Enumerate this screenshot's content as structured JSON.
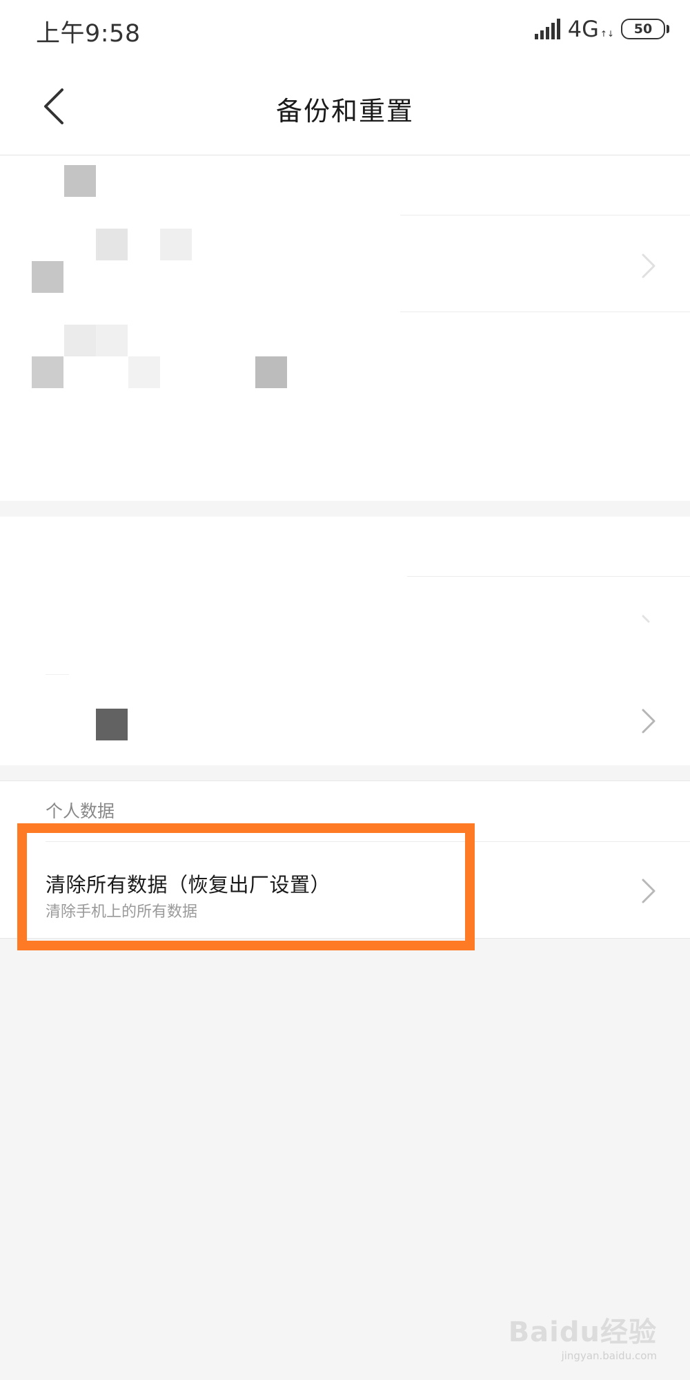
{
  "status_bar": {
    "time": "上午9:58",
    "network": "4G",
    "network_arrows": "↑↓",
    "battery": "50"
  },
  "header": {
    "title": "备份和重置",
    "back_icon": "chevron-left-icon"
  },
  "personal_data": {
    "label": "个人数据",
    "factory_reset": {
      "title": "清除所有数据（恢复出厂设置）",
      "subtitle": "清除手机上的所有数据"
    }
  },
  "watermark": {
    "logo": "Baidu经验",
    "url": "jingyan.baidu.com"
  },
  "colors": {
    "highlight": "#ff7a24",
    "background": "#f5f5f5"
  }
}
